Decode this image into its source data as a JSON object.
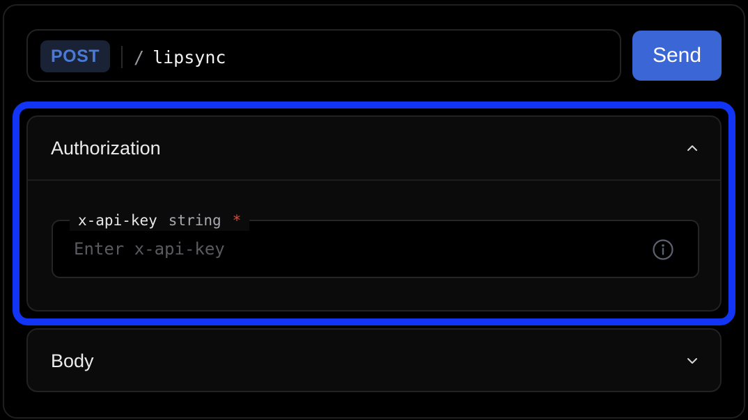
{
  "request": {
    "method": "POST",
    "path_separator": "/",
    "path": "lipsync",
    "send_label": "Send"
  },
  "sections": {
    "authorization": {
      "title": "Authorization",
      "expanded": true,
      "toggle_icon": "chevron-up-icon",
      "field": {
        "name": "x-api-key",
        "type": "string",
        "required_mark": "*",
        "value": "",
        "placeholder": "Enter x-api-key",
        "info_icon": "info-icon"
      }
    },
    "body": {
      "title": "Body",
      "expanded": false,
      "toggle_icon": "chevron-down-icon"
    }
  },
  "colors": {
    "accent": "#3a66d6",
    "method_text": "#4a7ad6",
    "highlight": "#1235f5",
    "required": "#d24a3a"
  }
}
